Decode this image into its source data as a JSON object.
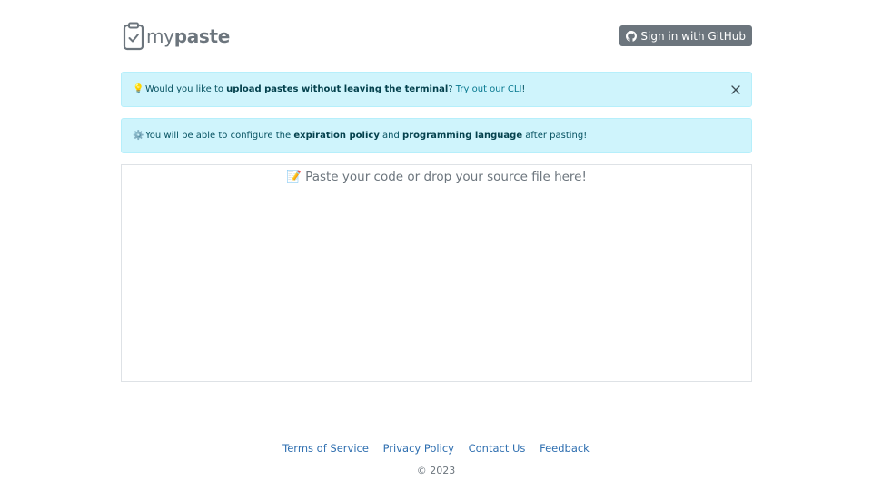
{
  "header": {
    "logo_prefix": "my",
    "logo_suffix": "paste",
    "signin_label": "Sign in with GitHub",
    "signin_icon": "github-icon"
  },
  "alerts": {
    "cli": {
      "icon": "lightbulb-icon",
      "pre": "Would you like to ",
      "bold": "upload pastes without leaving the terminal",
      "mid": "? ",
      "link": "Try out our CLI",
      "post": "!"
    },
    "config": {
      "icon": "gear-icon",
      "pre": "You will be able to configure the ",
      "bold1": "expiration policy",
      "mid": " and ",
      "bold2": "programming language",
      "post": " after pasting!"
    }
  },
  "paste": {
    "placeholder": "📝 Paste your code or drop your source file here!"
  },
  "footer": {
    "links": [
      "Terms of Service",
      "Privacy Policy",
      "Contact Us",
      "Feedback"
    ],
    "copyright": "© 2023"
  },
  "colors": {
    "alert_bg": "#cff4fc",
    "alert_text": "#055160",
    "button_bg": "#6c757d",
    "link": "#2f6fb0"
  }
}
